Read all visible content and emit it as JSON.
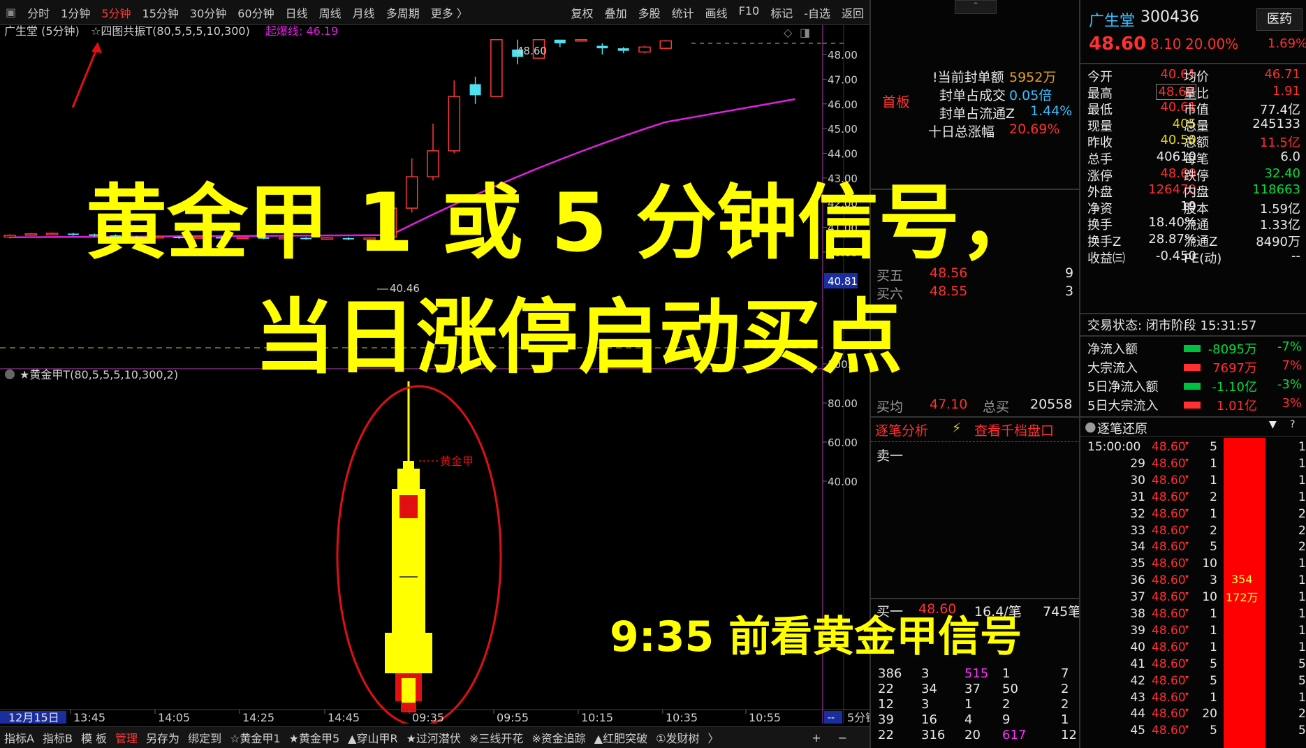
{
  "toolbar": {
    "periods": [
      "分时",
      "1分钟",
      "5分钟",
      "15分钟",
      "30分钟",
      "60分钟",
      "日线",
      "周线",
      "月线",
      "多周期",
      "更多 〉"
    ],
    "active_period": "5分钟",
    "tools": [
      "复权",
      "叠加",
      "多股",
      "统计",
      "画线",
      "F10",
      "标记",
      "-自选",
      "返回"
    ]
  },
  "chart": {
    "stock_label": "广生堂 (5分钟)",
    "indicator1": "☆四图共振T(80,5,5,5,10,300)",
    "indicator1_line_label": "起爆线: 46.19",
    "indicator2": "★黄金甲T(80,5,5,5,10,300,2)",
    "marker_high": "48.60",
    "marker_low": "40.46",
    "current_price_tag": "40.81",
    "golden_label": "黄金甲",
    "price_axis": [
      "48.00",
      "47.00",
      "46.00",
      "45.00",
      "44.00",
      "43.00",
      "42.00",
      "41.00",
      "40.00"
    ],
    "indicator_axis": [
      "100.0",
      "80.00",
      "60.00",
      "40.00"
    ],
    "time_axis": [
      "12月15日",
      "13:45",
      "14:05",
      "14:25",
      "14:45",
      "09:35",
      "09:55",
      "10:15",
      "10:35",
      "10:55"
    ],
    "period_tag": "5分钟",
    "candles": [
      {
        "o": 40.61,
        "c": 40.68,
        "h": 40.72,
        "l": 40.55
      },
      {
        "o": 40.7,
        "c": 40.74,
        "h": 40.78,
        "l": 40.66
      },
      {
        "o": 40.72,
        "c": 40.76,
        "h": 40.8,
        "l": 40.68
      },
      {
        "o": 40.75,
        "c": 40.7,
        "h": 40.78,
        "l": 40.66
      },
      {
        "o": 40.72,
        "c": 40.66,
        "h": 40.75,
        "l": 40.63
      },
      {
        "o": 40.68,
        "c": 40.62,
        "h": 40.72,
        "l": 40.58
      },
      {
        "o": 40.63,
        "c": 40.59,
        "h": 40.66,
        "l": 40.55
      },
      {
        "o": 40.6,
        "c": 40.63,
        "h": 40.68,
        "l": 40.56
      },
      {
        "o": 40.62,
        "c": 40.58,
        "h": 40.65,
        "l": 40.54
      },
      {
        "o": 40.58,
        "c": 40.62,
        "h": 40.66,
        "l": 40.55
      },
      {
        "o": 40.61,
        "c": 40.57,
        "h": 40.64,
        "l": 40.53
      },
      {
        "o": 40.57,
        "c": 40.6,
        "h": 40.63,
        "l": 40.52
      },
      {
        "o": 40.6,
        "c": 40.56,
        "h": 40.63,
        "l": 40.52
      },
      {
        "o": 40.56,
        "c": 40.59,
        "h": 40.62,
        "l": 40.52
      },
      {
        "o": 40.58,
        "c": 40.55,
        "h": 40.61,
        "l": 40.5
      },
      {
        "o": 40.55,
        "c": 40.58,
        "h": 40.61,
        "l": 40.5
      },
      {
        "o": 40.57,
        "c": 40.54,
        "h": 40.6,
        "l": 40.48
      },
      {
        "o": 40.54,
        "c": 40.57,
        "h": 40.6,
        "l": 40.46
      },
      {
        "o": 40.61,
        "c": 41.78,
        "h": 42.35,
        "l": 40.61
      },
      {
        "o": 41.78,
        "c": 43.05,
        "h": 43.8,
        "l": 41.6
      },
      {
        "o": 43.05,
        "c": 44.1,
        "h": 45.2,
        "l": 42.9
      },
      {
        "o": 44.1,
        "c": 46.3,
        "h": 46.95,
        "l": 44.0
      },
      {
        "o": 46.8,
        "c": 46.35,
        "h": 47.1,
        "l": 46.0
      },
      {
        "o": 46.3,
        "c": 48.6,
        "h": 48.6,
        "l": 46.3
      },
      {
        "o": 48.2,
        "c": 47.9,
        "h": 48.6,
        "l": 47.6
      },
      {
        "o": 47.85,
        "c": 48.6,
        "h": 48.6,
        "l": 47.85
      },
      {
        "o": 48.6,
        "c": 48.45,
        "h": 48.6,
        "l": 48.3
      },
      {
        "o": 48.6,
        "c": 48.6,
        "h": 48.6,
        "l": 48.6
      },
      {
        "o": 48.35,
        "c": 48.25,
        "h": 48.45,
        "l": 48.0
      },
      {
        "o": 48.25,
        "c": 48.15,
        "h": 48.3,
        "l": 48.05
      },
      {
        "o": 48.1,
        "c": 48.3,
        "h": 48.35,
        "l": 48.05
      },
      {
        "o": 48.25,
        "c": 48.55,
        "h": 48.6,
        "l": 48.2
      }
    ]
  },
  "order_panel": {
    "seal_amount_label": "!当前封单额",
    "seal_amount": "5952万",
    "seal_trade_label": "封单占成交",
    "seal_trade": "0.05倍",
    "seal_float_label": "封单占流通Z",
    "seal_float": "1.44%",
    "ten_day_label": "十日总涨幅",
    "ten_day": "20.69%",
    "first_board": "首板",
    "bid_rows": [
      {
        "label": "买五",
        "price": "48.56",
        "vol": "9"
      },
      {
        "label": "买六",
        "price": "48.55",
        "vol": "3"
      }
    ],
    "avg_buy_label": "买均",
    "avg_buy": "47.10",
    "total_buy_label": "总买",
    "total_buy": "20558",
    "tab_analysis": "逐笔分析",
    "tab_thousand": "查看千档盘口",
    "sell_one": "卖一",
    "buy_one_label": "买一",
    "buy_one_price": "48.60",
    "buy_one_per": "16.4/笔",
    "buy_one_vol": "745笔",
    "queue_rows": [
      [
        "386",
        "3",
        "515",
        "1",
        "7"
      ],
      [
        "22",
        "34",
        "37",
        "50",
        "2"
      ],
      [
        "12",
        "3",
        "1",
        "2",
        "2"
      ],
      [
        "39",
        "16",
        "4",
        "9",
        "1"
      ],
      [
        "22",
        "316",
        "20",
        "617",
        "12"
      ]
    ]
  },
  "quote_panel": {
    "name": "广生堂",
    "code": "300436",
    "sector": "医药",
    "price": "48.60",
    "change": "8.10",
    "pct": "20.00%",
    "sector_pct": "1.69%",
    "stats": [
      [
        "今开",
        "40.61",
        "均价",
        "46.71"
      ],
      [
        "最高",
        "48.60",
        "量比",
        "1.91"
      ],
      [
        "最低",
        "40.61",
        "市值",
        "77.4亿"
      ],
      [
        "现量",
        "405",
        "总量",
        "245133"
      ],
      [
        "昨收",
        "40.50",
        "总额",
        "11.5亿"
      ],
      [
        "总手",
        "40610",
        "每笔",
        "6.0"
      ],
      [
        "涨停",
        "48.60",
        "跌停",
        "32.40"
      ],
      [
        "外盘",
        "126470",
        "内盘",
        "118663"
      ],
      [
        "净资",
        "19",
        "股本",
        "1.59亿"
      ],
      [
        "换手",
        "18.40%",
        "流通",
        "1.33亿"
      ],
      [
        "换手Z",
        "28.87%",
        "流通Z",
        "8490万"
      ],
      [
        "收益㈢",
        "-0.450",
        "PE(动)",
        "--"
      ]
    ],
    "trade_status": "交易状态: 闭市阶段 15:31:57",
    "flows": [
      {
        "label": "净流入额",
        "value": "-8095万",
        "pct": "-7%",
        "color": "#00c040"
      },
      {
        "label": "大宗流入",
        "value": "7697万",
        "pct": "7%",
        "color": "#ff3030"
      },
      {
        "label": "5日净流入额",
        "value": "-1.10亿",
        "pct": "-3%",
        "color": "#00c040"
      },
      {
        "label": "5日大宗流入",
        "value": "1.01亿",
        "pct": "3%",
        "color": "#ff3030"
      }
    ],
    "ticks_title": "逐笔还原",
    "ticks": [
      [
        "15:00:00",
        "48.60",
        "5"
      ],
      [
        "29",
        "48.60",
        "1"
      ],
      [
        "30",
        "48.60",
        "1"
      ],
      [
        "31",
        "48.60",
        "2"
      ],
      [
        "32",
        "48.60",
        "1"
      ],
      [
        "33",
        "48.60",
        "2"
      ],
      [
        "34",
        "48.60",
        "5"
      ],
      [
        "35",
        "48.60",
        "10"
      ],
      [
        "36",
        "48.60",
        "3"
      ],
      [
        "37",
        "48.60",
        "10"
      ],
      [
        "38",
        "48.60",
        "1"
      ],
      [
        "39",
        "48.60",
        "1"
      ],
      [
        "40",
        "48.60",
        "1"
      ],
      [
        "41",
        "48.60",
        "5"
      ],
      [
        "42",
        "48.60",
        "5"
      ],
      [
        "43",
        "48.60",
        "1"
      ],
      [
        "44",
        "48.60",
        "20"
      ],
      [
        "45",
        "48.60",
        "5"
      ]
    ],
    "ticks_extra": [
      "1",
      "1",
      "1",
      "1",
      "2",
      "2",
      "2",
      "10",
      "1",
      "10",
      "1",
      "1",
      "1",
      "5",
      "5",
      "1",
      "20",
      "5"
    ],
    "bar_value1": "354",
    "bar_value2": "172万"
  },
  "statusbar": {
    "items": [
      "指标A",
      "指标B",
      "模 板",
      "管理",
      "另存为",
      "绑定到",
      "☆黄金甲1",
      "★黄金甲5",
      "▲穿山甲R",
      "★过河潜伏",
      "※三线开花",
      "※资金追踪",
      "▲红肥突破",
      "①发财树",
      "〉"
    ],
    "active": "管理",
    "right": [
      "+",
      "−"
    ]
  },
  "overlay": {
    "title_line1": "黄金甲 1 或 5 分钟信号，",
    "title_line2": "当日涨停启动买点",
    "subtitle": "9:35 前看黄金甲信号"
  }
}
